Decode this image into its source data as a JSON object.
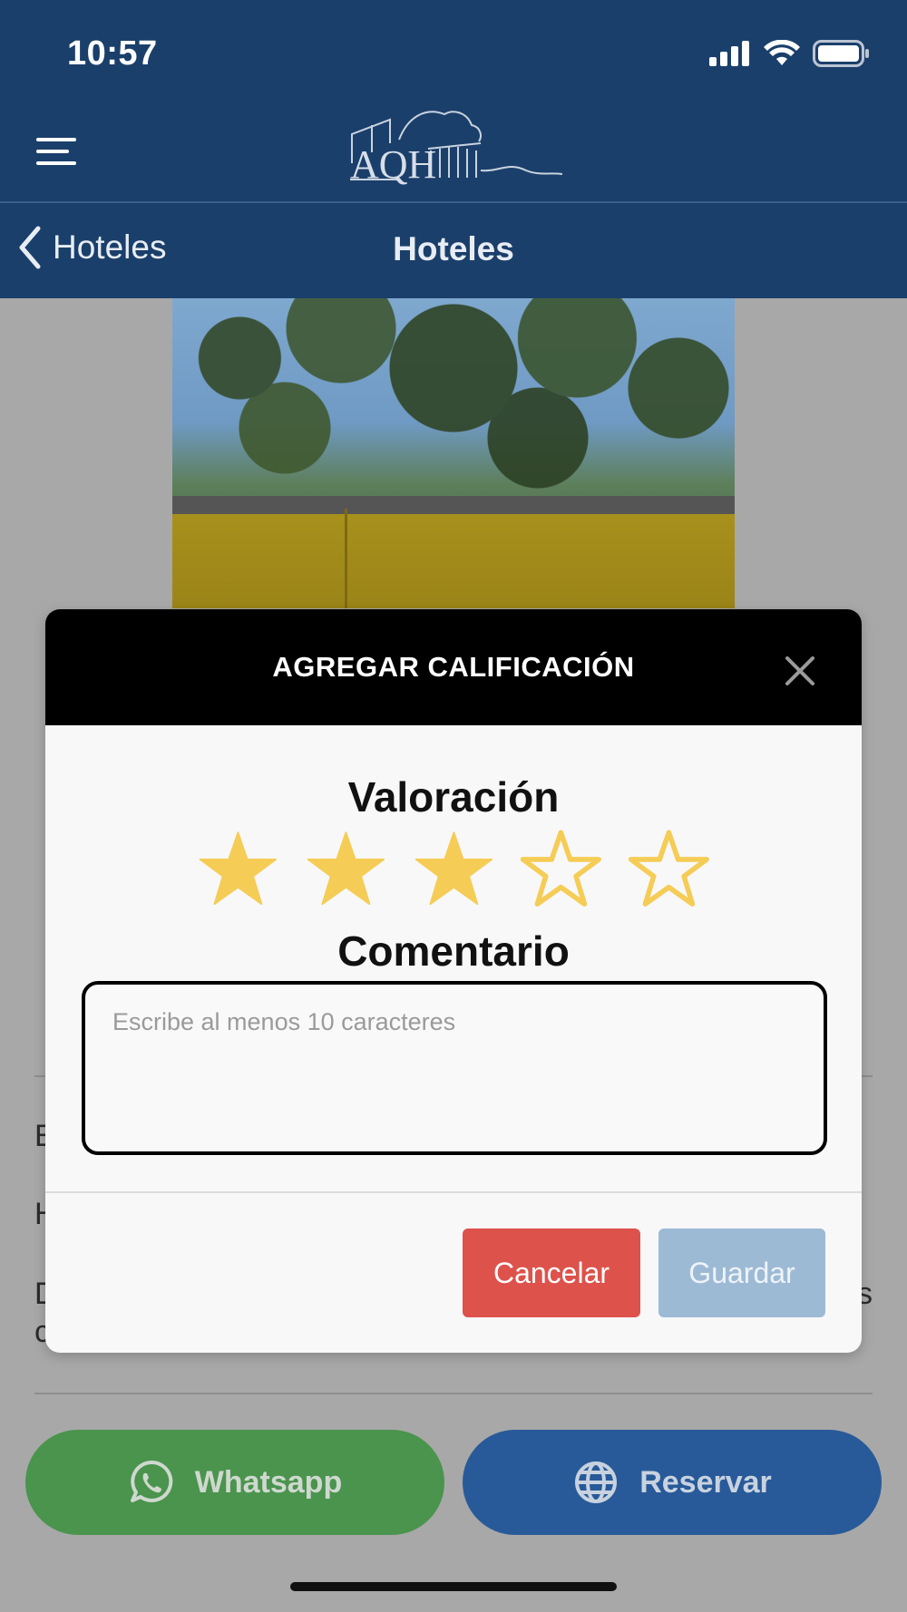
{
  "status_bar": {
    "time": "10:57"
  },
  "header": {
    "logo_text": "AQH"
  },
  "navbar": {
    "back_label": "Hoteles",
    "title": "Hoteles"
  },
  "background_peek": {
    "line1_start": "E",
    "line2_start": "H",
    "line3_start": "D",
    "line3_end": "s",
    "line4_start": "c"
  },
  "modal": {
    "title": "AGREGAR CALIFICACIÓN",
    "rating_label": "Valoración",
    "rating": 3,
    "max_rating": 5,
    "comment_label": "Comentario",
    "comment_value": "",
    "comment_placeholder": "Escribe al menos 10 caracteres",
    "cancel_label": "Cancelar",
    "save_label": "Guardar"
  },
  "actions": {
    "whatsapp_label": "Whatsapp",
    "reservar_label": "Reservar"
  },
  "colors": {
    "header_bg": "#1b3f6b",
    "star_color": "#f5cc55",
    "cancel_bg": "#de524c",
    "save_bg": "#9dbad5",
    "whatsapp_bg": "#4a944d",
    "reservar_bg": "#285a99"
  },
  "icons": {
    "menu": "hamburger-icon",
    "back": "chevron-left-icon",
    "close": "close-icon",
    "star": "star-icon",
    "whatsapp": "whatsapp-icon",
    "globe": "globe-icon",
    "signal": "cellular-signal-icon",
    "wifi": "wifi-icon",
    "battery": "battery-icon"
  }
}
